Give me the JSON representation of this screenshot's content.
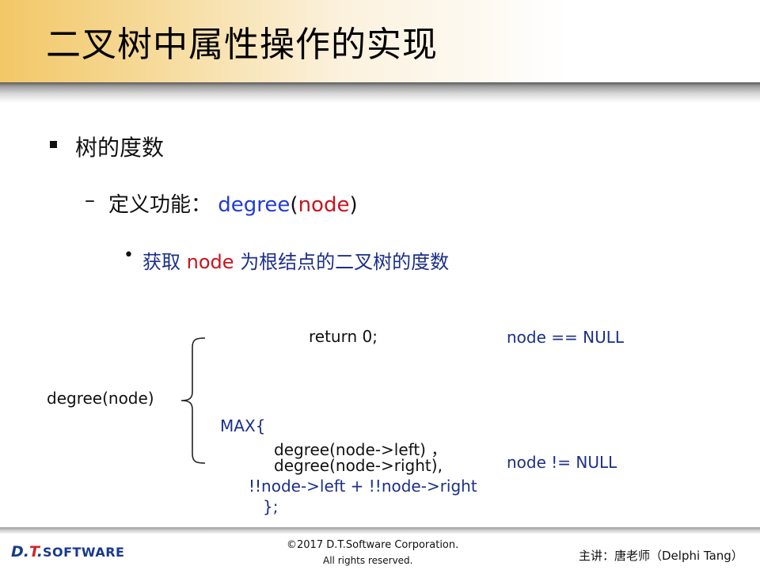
{
  "slide": {
    "title": "二叉树中属性操作的实现",
    "level1": "树的度数",
    "level2": {
      "dash": "–",
      "label": "定义功能：",
      "func": "degree",
      "paren_open": "(",
      "arg": "node",
      "paren_close": ")"
    },
    "level3": {
      "dot": "•",
      "prefix": "获取",
      "node_word": "node",
      "suffix": "为根结点的二叉树的度数"
    },
    "definition": {
      "lhs": "degree(node)",
      "case1_expr": "return 0;",
      "case1_cond": "node == NULL",
      "case2_line1": "MAX{",
      "case2_line2": "degree(node->left) ，",
      "case2_line3": "degree(node->right),",
      "case2_line4": "!!node->left + !!node->right",
      "case2_line5": "};",
      "case2_cond": "node != NULL"
    }
  },
  "footer": {
    "logo_d": "D",
    "logo_dot1": ".",
    "logo_t": "T",
    "logo_dot2": ".",
    "logo_software": "SOFTWARE",
    "copyright_line1": "©2017 D.T.Software Corporation.",
    "copyright_line2": "All rights reserved.",
    "lecturer": "主讲：唐老师（Delphi Tang）"
  },
  "colors": {
    "title_gradient_start": "#f2c766",
    "blue_text": "#1f3bd6",
    "red_text": "#c8141e",
    "navy_text": "#1c2f8a"
  }
}
